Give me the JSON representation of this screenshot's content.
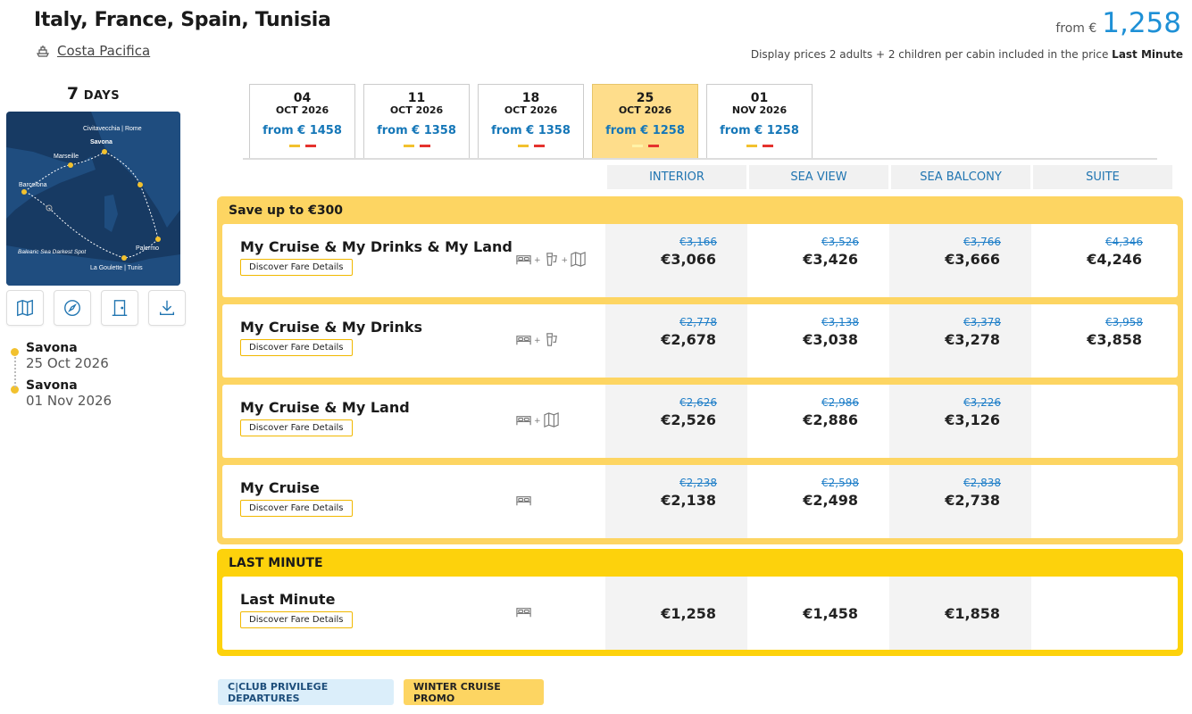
{
  "header": {
    "title": "Italy, France, Spain, Tunisia",
    "ship_name": "Costa Pacifica",
    "price_from_label": "from €",
    "price_from_value": "1,258",
    "display_note_prefix": "Display prices 2 adults + 2 children per cabin included in the price",
    "display_note_bold": "Last Minute"
  },
  "sidebar": {
    "days_number": "7",
    "days_label": "DAYS",
    "map_labels": {
      "civitavecchia": "Civitavecchia | Rome",
      "savona": "Savona",
      "marseille": "Marseille",
      "barcelona": "Barcelona",
      "balearic": "Balearic Sea Darkest Spot",
      "palermo": "Palermo",
      "lagoulette": "La Goulette | Tunis"
    },
    "tool_icons": [
      "map-icon",
      "compass-icon",
      "cabin-door-icon",
      "download-icon"
    ],
    "itinerary": [
      {
        "port": "Savona",
        "date": "25 Oct 2026"
      },
      {
        "port": "Savona",
        "date": "01 Nov 2026"
      }
    ]
  },
  "date_tabs": [
    {
      "day": "04",
      "month": "OCT 2026",
      "price": "from € 1458",
      "selected": false
    },
    {
      "day": "11",
      "month": "OCT 2026",
      "price": "from € 1358",
      "selected": false
    },
    {
      "day": "18",
      "month": "OCT 2026",
      "price": "from € 1358",
      "selected": false
    },
    {
      "day": "25",
      "month": "OCT 2026",
      "price": "from € 1258",
      "selected": true
    },
    {
      "day": "01",
      "month": "NOV 2026",
      "price": "from € 1258",
      "selected": false
    }
  ],
  "cabin_columns": [
    "INTERIOR",
    "SEA VIEW",
    "SEA BALCONY",
    "SUITE"
  ],
  "fare_button_label": "Discover Fare Details",
  "groups": [
    {
      "title": "Save up to €300",
      "rows": [
        {
          "name": "My Cruise & My Drinks & My Land",
          "icons": [
            "bed-icon",
            "drink-icon",
            "land-map-icon"
          ],
          "prices": [
            {
              "old": "€3,166",
              "new": "€3,066"
            },
            {
              "old": "€3,526",
              "new": "€3,426"
            },
            {
              "old": "€3,766",
              "new": "€3,666"
            },
            {
              "old": "€4,346",
              "new": "€4,246"
            }
          ]
        },
        {
          "name": "My Cruise & My Drinks",
          "icons": [
            "bed-icon",
            "drink-icon"
          ],
          "prices": [
            {
              "old": "€2,778",
              "new": "€2,678"
            },
            {
              "old": "€3,138",
              "new": "€3,038"
            },
            {
              "old": "€3,378",
              "new": "€3,278"
            },
            {
              "old": "€3,958",
              "new": "€3,858"
            }
          ]
        },
        {
          "name": "My Cruise & My Land",
          "icons": [
            "bed-icon",
            "land-map-icon"
          ],
          "prices": [
            {
              "old": "€2,626",
              "new": "€2,526"
            },
            {
              "old": "€2,986",
              "new": "€2,886"
            },
            {
              "old": "€3,226",
              "new": "€3,126"
            },
            null
          ]
        },
        {
          "name": "My Cruise",
          "icons": [
            "bed-icon"
          ],
          "prices": [
            {
              "old": "€2,238",
              "new": "€2,138"
            },
            {
              "old": "€2,598",
              "new": "€2,498"
            },
            {
              "old": "€2,838",
              "new": "€2,738"
            },
            null
          ]
        }
      ]
    },
    {
      "title": "LAST MINUTE",
      "rows": [
        {
          "name": "Last Minute",
          "icons": [
            "bed-icon"
          ],
          "prices": [
            {
              "new": "€1,258"
            },
            {
              "new": "€1,458"
            },
            {
              "new": "€1,858"
            },
            null
          ]
        }
      ]
    }
  ],
  "badges": [
    "C|CLUB PRIVILEGE DEPARTURES",
    "WINTER CRUISE PROMO"
  ],
  "colors": {
    "accent_blue": "#1e90d6",
    "group_save": "#fdd562",
    "group_last": "#fdd20c",
    "selected_tab": "#fedd8b"
  }
}
